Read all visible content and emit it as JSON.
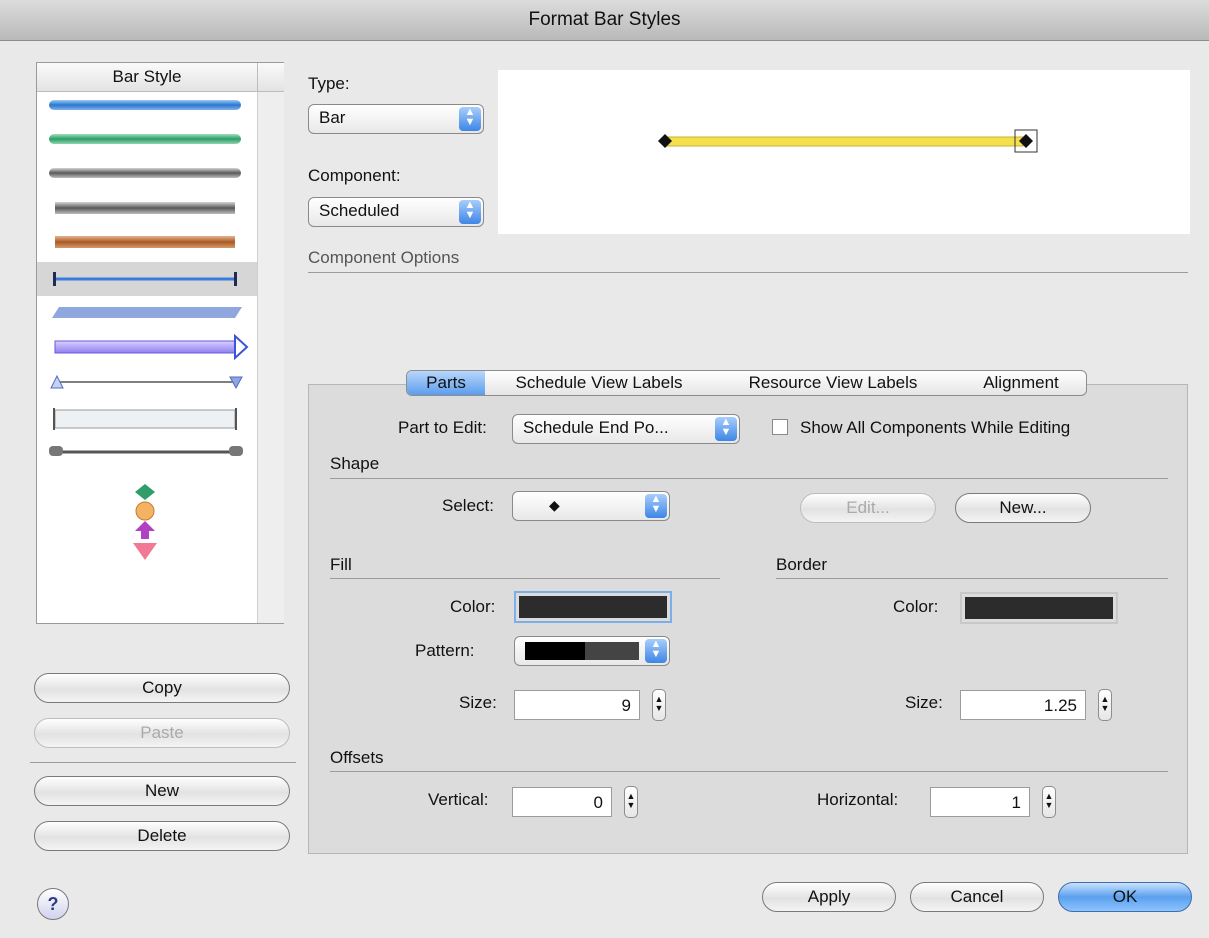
{
  "window": {
    "title": "Format Bar Styles"
  },
  "bar_style_list": {
    "header": "Bar Style",
    "selected_index": 5
  },
  "left_buttons": {
    "copy": "Copy",
    "paste": "Paste",
    "new": "New",
    "delete": "Delete"
  },
  "type": {
    "label": "Type:",
    "value": "Bar"
  },
  "component": {
    "label": "Component:",
    "value": "Scheduled"
  },
  "component_options": {
    "label": "Component Options"
  },
  "tabs": [
    "Parts",
    "Schedule View Labels",
    "Resource View Labels",
    "Alignment"
  ],
  "parts": {
    "part_to_edit_label": "Part to Edit:",
    "part_to_edit_value": "Schedule End Po...",
    "show_all_label": "Show All Components While Editing",
    "shape_header": "Shape",
    "select_label": "Select:",
    "edit_button": "Edit...",
    "new_button": "New...",
    "fill_header": "Fill",
    "border_header": "Border",
    "fill_color_label": "Color:",
    "pattern_label": "Pattern:",
    "fill_size_label": "Size:",
    "fill_size_value": "9",
    "border_color_label": "Color:",
    "border_size_label": "Size:",
    "border_size_value": "1.25",
    "offsets_header": "Offsets",
    "vertical_label": "Vertical:",
    "vertical_value": "0",
    "horizontal_label": "Horizontal:",
    "horizontal_value": "1"
  },
  "footer": {
    "help": "?",
    "apply": "Apply",
    "cancel": "Cancel",
    "ok": "OK"
  },
  "colors": {
    "preview_bar": "#f4e04a",
    "fill_color": "#2c2c2c",
    "border_color": "#2c2c2c",
    "accent": "#5aa0ee"
  }
}
